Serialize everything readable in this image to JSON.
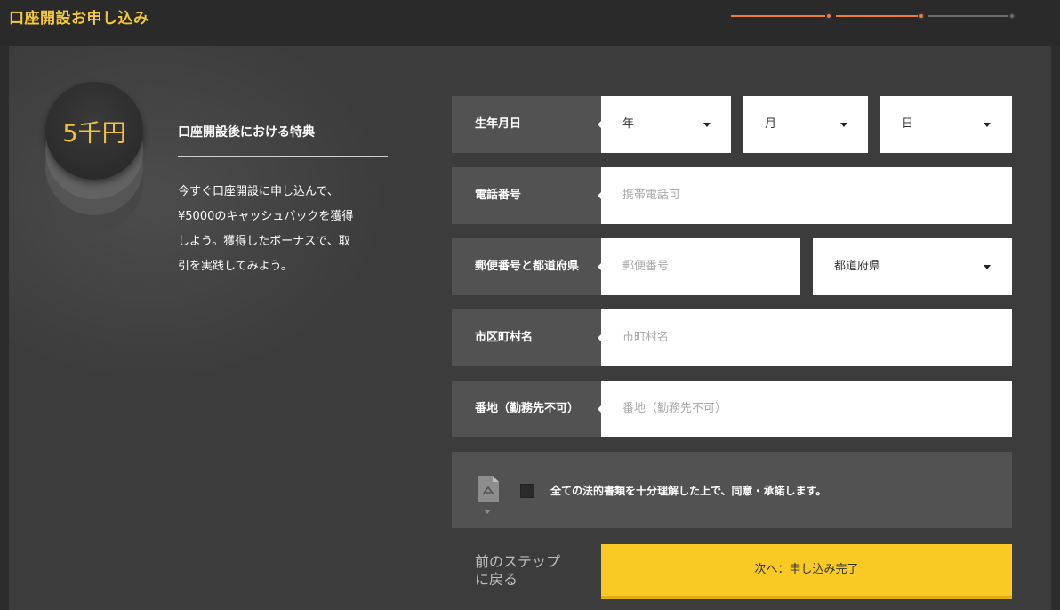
{
  "header": {
    "title": "口座開設お申し込み",
    "progress": {
      "steps": 3,
      "current_step": 2,
      "active_color": "#f07a3a",
      "inactive_color": "#6a6a6a"
    }
  },
  "benefit": {
    "coin_label": "5千円",
    "title": "口座開設後における特典",
    "lines": [
      "今すぐ口座開設に申し込んで、",
      "¥5000のキャッシュバックを獲得",
      "しよう。獲得したボーナスで、取",
      "引を実践してみよう。"
    ]
  },
  "form": {
    "birthdate": {
      "label": "生年月日",
      "year": "年",
      "month": "月",
      "day": "日"
    },
    "phone": {
      "label": "電話番号",
      "placeholder": "携帯電話可"
    },
    "postal": {
      "label": "郵便番号と都道府県",
      "postal_placeholder": "郵便番号",
      "prefecture": "都道府県"
    },
    "city": {
      "label": "市区町村名",
      "placeholder": "市町村名"
    },
    "address": {
      "label": "番地（勤務先不可）",
      "placeholder": "番地（勤務先不可）"
    }
  },
  "agreement": {
    "icon": "pdf-icon",
    "text": "全ての法的書類を十分理解した上で、同意・承諾します。",
    "checked": false
  },
  "actions": {
    "back_line1": "前のステップ",
    "back_line2": "に戻る",
    "next": "次へ：申し込み完了"
  },
  "colors": {
    "accent": "#f6c83a",
    "button": "#f9c924",
    "progress": "#f07a3a"
  }
}
